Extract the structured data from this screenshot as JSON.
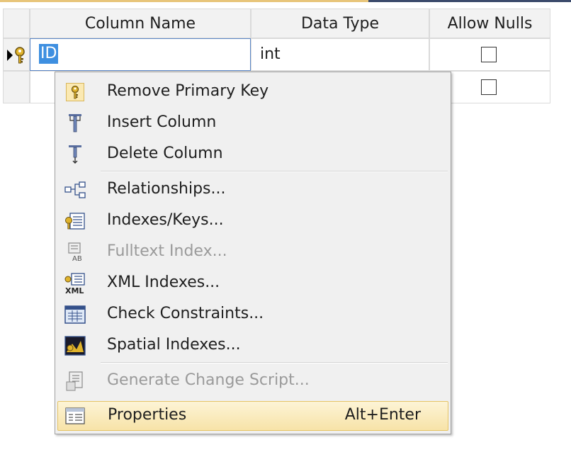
{
  "table": {
    "columns": [
      "Column Name",
      "Data Type",
      "Allow Nulls"
    ],
    "rows": [
      {
        "name": "ID",
        "type": "int",
        "allow_nulls": false
      },
      {
        "name": "",
        "type": "",
        "allow_nulls": false
      }
    ]
  },
  "context_menu": {
    "items": [
      {
        "label": "Remove Primary Key",
        "icon": "key-icon",
        "enabled": true
      },
      {
        "label": "Insert Column",
        "icon": "insert-column-icon",
        "enabled": true
      },
      {
        "label": "Delete Column",
        "icon": "delete-column-icon",
        "enabled": true
      },
      {
        "label": "Relationships...",
        "icon": "relationships-icon",
        "enabled": true
      },
      {
        "label": "Indexes/Keys...",
        "icon": "indexes-keys-icon",
        "enabled": true
      },
      {
        "label": "Fulltext Index...",
        "icon": "fulltext-index-icon",
        "enabled": false
      },
      {
        "label": "XML Indexes...",
        "icon": "xml-indexes-icon",
        "enabled": true
      },
      {
        "label": "Check Constraints...",
        "icon": "check-constraints-icon",
        "enabled": true
      },
      {
        "label": "Spatial Indexes...",
        "icon": "spatial-indexes-icon",
        "enabled": true
      },
      {
        "label": "Generate Change Script...",
        "icon": "generate-script-icon",
        "enabled": false
      },
      {
        "label": "Properties",
        "icon": "properties-icon",
        "enabled": true,
        "shortcut": "Alt+Enter",
        "highlighted": true
      }
    ]
  },
  "colors": {
    "selection": "#3e8fe0",
    "menu_highlight": "#f7e3a8",
    "menu_bg": "#f0f0f0"
  }
}
